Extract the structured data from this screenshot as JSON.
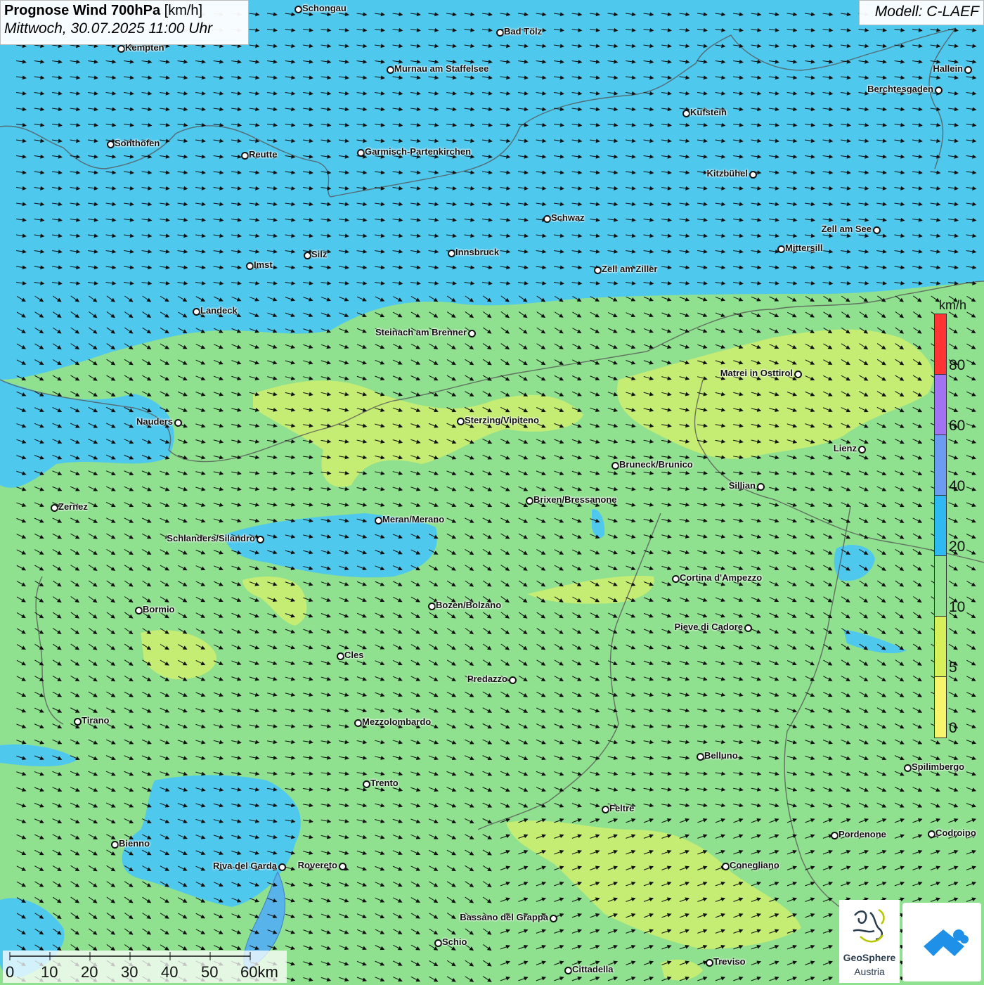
{
  "header": {
    "title_bold": "Prognose Wind 700hPa",
    "title_unit": "[km/h]",
    "subtitle": "Mittwoch, 30.07.2025 11:00 Uhr"
  },
  "model": {
    "label": "Modell: C-LAEF"
  },
  "legend": {
    "unit": "km/h",
    "labels": [
      "80",
      "60",
      "40",
      "20",
      "10",
      "5",
      "0"
    ],
    "colors": [
      "#ff3333",
      "#a173f2",
      "#6b9cf2",
      "#2fb9f3",
      "#8fe08f",
      "#d7f05a",
      "#f7f56b"
    ]
  },
  "scalebar": {
    "labels": [
      "0",
      "10",
      "20",
      "30",
      "40",
      "50",
      "60km"
    ]
  },
  "logos": {
    "geosphere_line1": "GeoSphere",
    "geosphere_line2": "Austria"
  },
  "cities": [
    {
      "name": "Schongau"
    },
    {
      "name": "Bad Tölz"
    },
    {
      "name": "Kempten"
    },
    {
      "name": "Murnau am Staffelsee"
    },
    {
      "name": "Hallein"
    },
    {
      "name": "Berchtesgaden"
    },
    {
      "name": "Kufstein"
    },
    {
      "name": "Sonthofen"
    },
    {
      "name": "Reutte"
    },
    {
      "name": "Garmisch-Partenkirchen"
    },
    {
      "name": "Kitzbühel"
    },
    {
      "name": "Schwaz"
    },
    {
      "name": "Zell am See"
    },
    {
      "name": "Mittersill"
    },
    {
      "name": "Imst"
    },
    {
      "name": "Silz"
    },
    {
      "name": "Innsbruck"
    },
    {
      "name": "Zell am Ziller"
    },
    {
      "name": "Landeck"
    },
    {
      "name": "Steinach am Brenner"
    },
    {
      "name": "Matrei in Osttirol"
    },
    {
      "name": "Nauders"
    },
    {
      "name": "Sterzing/Vipiteno"
    },
    {
      "name": "Lienz"
    },
    {
      "name": "Bruneck/Brunico"
    },
    {
      "name": "Sillian"
    },
    {
      "name": "Zernez"
    },
    {
      "name": "Brixen/Bressanone"
    },
    {
      "name": "Meran/Merano"
    },
    {
      "name": "Schlanders/Silandro"
    },
    {
      "name": "Cortina d'Ampezzo"
    },
    {
      "name": "Bozen/Bolzano"
    },
    {
      "name": "Bormio"
    },
    {
      "name": "Pieve di Cadore"
    },
    {
      "name": "Cles"
    },
    {
      "name": "Predazzo"
    },
    {
      "name": "Tirano"
    },
    {
      "name": "Mezzolombardo"
    },
    {
      "name": "Belluno"
    },
    {
      "name": "Spilimbergo"
    },
    {
      "name": "Trento"
    },
    {
      "name": "Feltre"
    },
    {
      "name": "Pordenone"
    },
    {
      "name": "Codroipo"
    },
    {
      "name": "Bienno"
    },
    {
      "name": "Riva del Garda"
    },
    {
      "name": "Rovereto"
    },
    {
      "name": "Conegliano"
    },
    {
      "name": "Bassano del Grappa"
    },
    {
      "name": "Schio"
    },
    {
      "name": "Treviso"
    },
    {
      "name": "Cittadella"
    }
  ]
}
